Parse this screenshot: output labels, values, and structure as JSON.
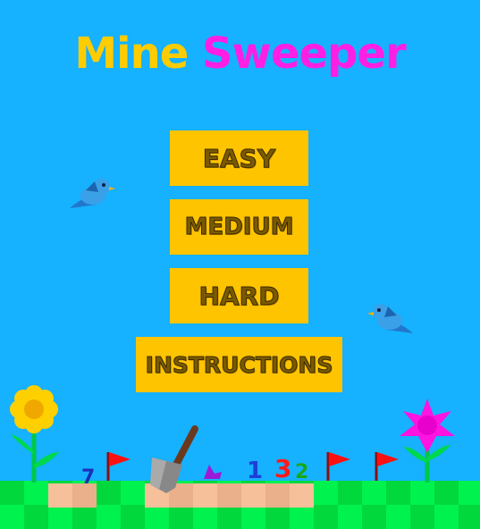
{
  "title": {
    "word1": "Mine",
    "word2": "Sweeper"
  },
  "menu": {
    "easy_label": "EASY",
    "medium_label": "MEDIUM",
    "hard_label": "HARD",
    "instructions_label": "INSTRUCTIONS"
  },
  "ground_numbers": {
    "n_blue": "1",
    "n_red": "3",
    "n_green": "2",
    "n_navy": "7"
  },
  "colors": {
    "sky": "#16b1ff",
    "title_mine": "#ffcc00",
    "title_sweeper": "#ff1fe4",
    "button": "#ffc400",
    "grass_light": "#00f24f",
    "grass_dark": "#00d83c",
    "sand": "#f5c09a"
  },
  "icons": [
    "bird-icon",
    "sunflower-icon",
    "pink-flower-icon",
    "flag-icon",
    "shovel-icon"
  ]
}
